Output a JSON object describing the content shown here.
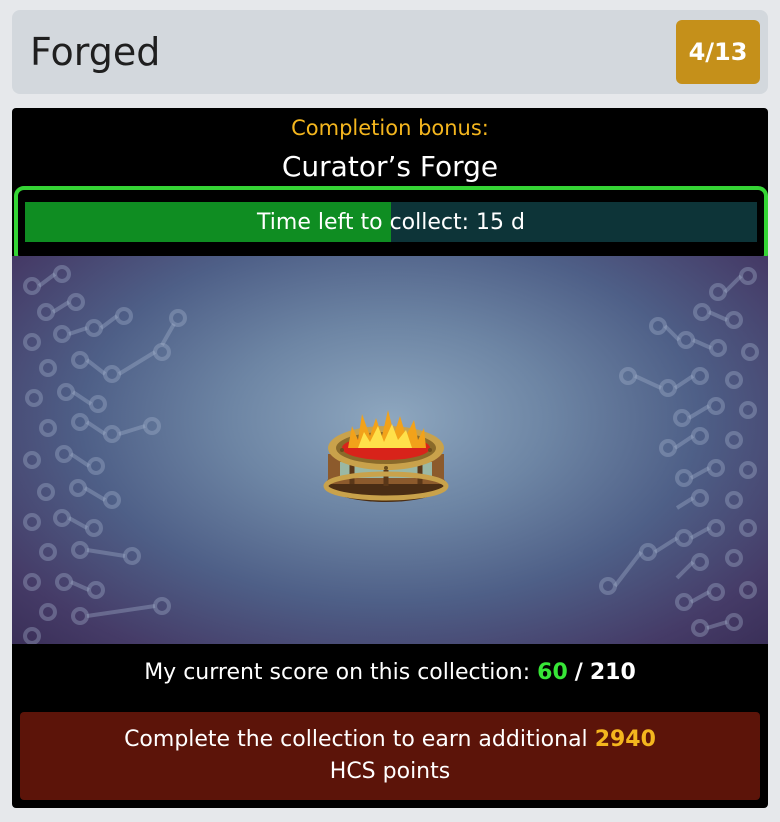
{
  "header": {
    "title": "Forged",
    "progress_badge": "4/13"
  },
  "bonus": {
    "label": "Completion bonus:",
    "name": "Curator’s Forge"
  },
  "timer": {
    "text": "Time left to collect: 15 d",
    "fill_fraction": 0.5
  },
  "item_icon": "fire-pit-icon",
  "score": {
    "label": "My current score on this collection:",
    "current": "60",
    "separator": "/",
    "total": "210"
  },
  "reward": {
    "text_before": "Complete the collection to earn additional",
    "points": "2940",
    "text_after": "HCS points"
  },
  "colors": {
    "accent_gold": "#f4b61e",
    "badge": "#c5901a",
    "timer_border": "#35d435",
    "timer_fill": "#0f8d22",
    "score_highlight": "#37e637",
    "reward_bg": "#5c1409"
  }
}
